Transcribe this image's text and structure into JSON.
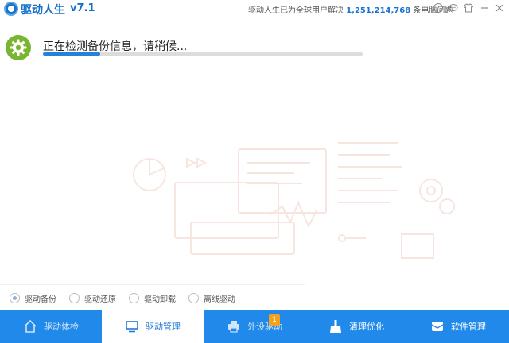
{
  "titlebar": {
    "app_name": "驱动人生",
    "version": "v7.1",
    "stats_prefix": "驱动人生已为全球用户解决",
    "stats_count": "1,251,214,768",
    "stats_suffix": "条电脑问题",
    "help_label": "?"
  },
  "progress": {
    "status_text": "正在检测备份信息，请稍候...",
    "percent": 18
  },
  "options": [
    {
      "label": "驱动备份",
      "checked": true
    },
    {
      "label": "驱动还原",
      "checked": false
    },
    {
      "label": "驱动卸载",
      "checked": false
    },
    {
      "label": "离线驱动",
      "checked": false
    }
  ],
  "nav": {
    "items": [
      {
        "label": "驱动体检",
        "icon": "house-icon"
      },
      {
        "label": "驱动管理",
        "icon": "monitor-icon"
      },
      {
        "label": "外设驱动",
        "icon": "printer-icon"
      },
      {
        "label": "清理优化",
        "icon": "broom-icon"
      },
      {
        "label": "软件管理",
        "icon": "package-icon"
      }
    ],
    "badge_count": "1"
  },
  "colors": {
    "accent": "#2089ea",
    "gear": "#79b531",
    "badge": "#f2a01e"
  }
}
